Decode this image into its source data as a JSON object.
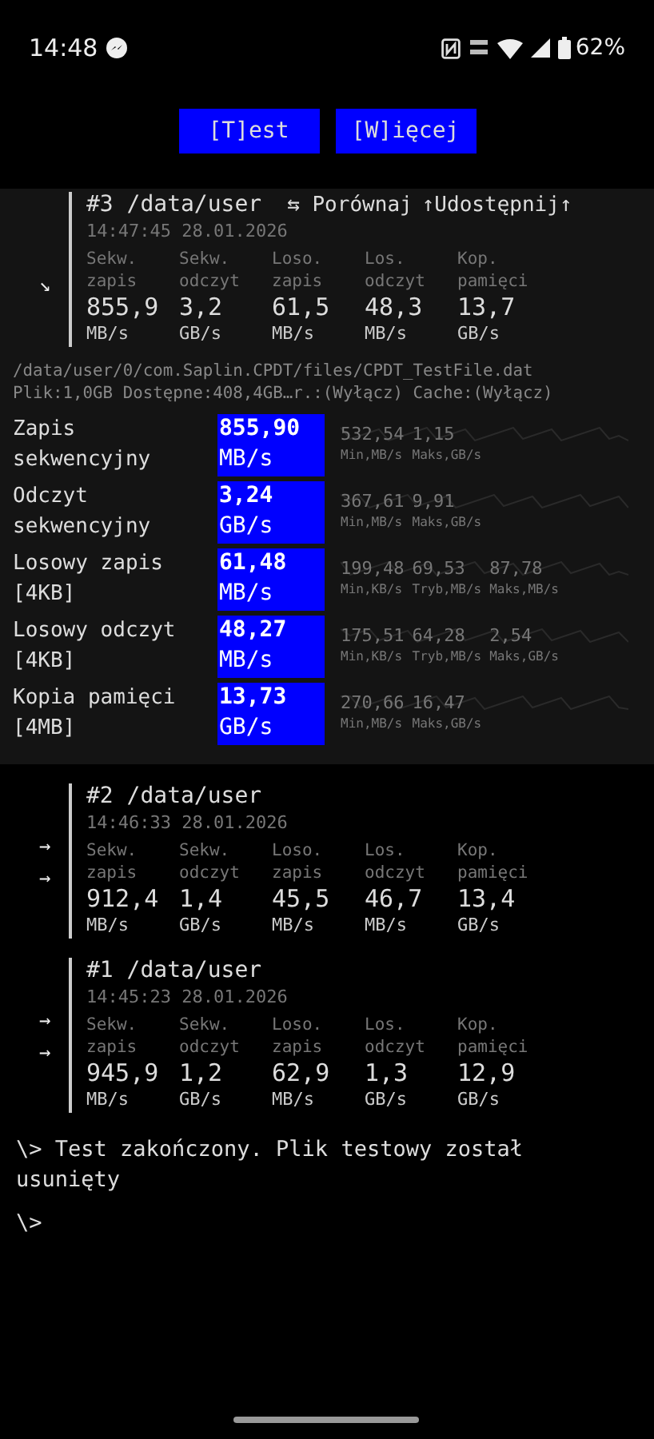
{
  "status_bar": {
    "time": "14:48",
    "battery": "62%"
  },
  "buttons": [
    {
      "label": "[T]est"
    },
    {
      "label": "[W]ięcej"
    }
  ],
  "runs": [
    {
      "title": "#3 /data/user",
      "time": "14:47:45 28.01.2026",
      "expanded": true,
      "markers": [
        "↘"
      ],
      "actions": [
        {
          "label": "⇆ Porównaj"
        },
        {
          "label": "↑Udostępnij↑"
        }
      ],
      "metrics": [
        {
          "label": "Sekw. zapis",
          "value": "855,9",
          "unit": "MB/s"
        },
        {
          "label": "Sekw. odczyt",
          "value": "3,2",
          "unit": "GB/s"
        },
        {
          "label": "Loso. zapis",
          "value": "61,5",
          "unit": "MB/s"
        },
        {
          "label": "Los. odczyt",
          "value": "48,3",
          "unit": "MB/s"
        },
        {
          "label": "Kop. pamięci",
          "value": "13,7",
          "unit": "GB/s"
        }
      ],
      "details": {
        "path": "/data/user/0/com.Saplin.CPDT/files/CPDT_TestFile.dat",
        "info": "Plik:1,0GB Dostępne:408,4GB…r.:(Wyłącz) Cache:(Wyłącz)",
        "tests": [
          {
            "name": "Zapis sekwencyjny",
            "value": "855,90",
            "unit": "MB/s",
            "stats": [
              {
                "value": "532,54",
                "label": "Min,MB/s"
              },
              {
                "value": "1,15",
                "label": "Maks,GB/s"
              }
            ]
          },
          {
            "name": "Odczyt sekwencyjny",
            "value": "3,24",
            "unit": "GB/s",
            "stats": [
              {
                "value": "367,61",
                "label": "Min,MB/s"
              },
              {
                "value": "9,91",
                "label": "Maks,GB/s"
              }
            ]
          },
          {
            "name": "Losowy zapis [4KB]",
            "value": "61,48",
            "unit": "MB/s",
            "stats": [
              {
                "value": "199,48",
                "label": "Min,KB/s"
              },
              {
                "value": "69,53",
                "label": "Tryb,MB/s"
              },
              {
                "value": "87,78",
                "label": "Maks,MB/s"
              }
            ]
          },
          {
            "name": "Losowy odczyt [4KB]",
            "value": "48,27",
            "unit": "MB/s",
            "stats": [
              {
                "value": "175,51",
                "label": "Min,KB/s"
              },
              {
                "value": "64,28",
                "label": "Tryb,MB/s"
              },
              {
                "value": "2,54",
                "label": "Maks,GB/s"
              }
            ]
          },
          {
            "name": "Kopia pamięci [4MB]",
            "value": "13,73",
            "unit": "GB/s",
            "stats": [
              {
                "value": "270,66",
                "label": "Min,MB/s"
              },
              {
                "value": "16,47",
                "label": "Maks,GB/s"
              }
            ]
          }
        ]
      }
    },
    {
      "title": "#2 /data/user",
      "time": "14:46:33 28.01.2026",
      "expanded": false,
      "markers": [
        "→",
        "→"
      ],
      "metrics": [
        {
          "label": "Sekw. zapis",
          "value": "912,4",
          "unit": "MB/s"
        },
        {
          "label": "Sekw. odczyt",
          "value": "1,4",
          "unit": "GB/s"
        },
        {
          "label": "Loso. zapis",
          "value": "45,5",
          "unit": "MB/s"
        },
        {
          "label": "Los. odczyt",
          "value": "46,7",
          "unit": "MB/s"
        },
        {
          "label": "Kop. pamięci",
          "value": "13,4",
          "unit": "GB/s"
        }
      ]
    },
    {
      "title": "#1 /data/user",
      "time": "14:45:23 28.01.2026",
      "expanded": false,
      "markers": [
        "→",
        "→"
      ],
      "metrics": [
        {
          "label": "Sekw. zapis",
          "value": "945,9",
          "unit": "MB/s"
        },
        {
          "label": "Sekw. odczyt",
          "value": "1,2",
          "unit": "GB/s"
        },
        {
          "label": "Loso. zapis",
          "value": "62,9",
          "unit": "MB/s"
        },
        {
          "label": "Los. odczyt",
          "value": "1,3",
          "unit": "GB/s"
        },
        {
          "label": "Kop. pamięci",
          "value": "12,9",
          "unit": "GB/s"
        }
      ]
    }
  ],
  "log": [
    "\\> Test zakończony. Plik testowy został usunięty",
    "\\>"
  ]
}
